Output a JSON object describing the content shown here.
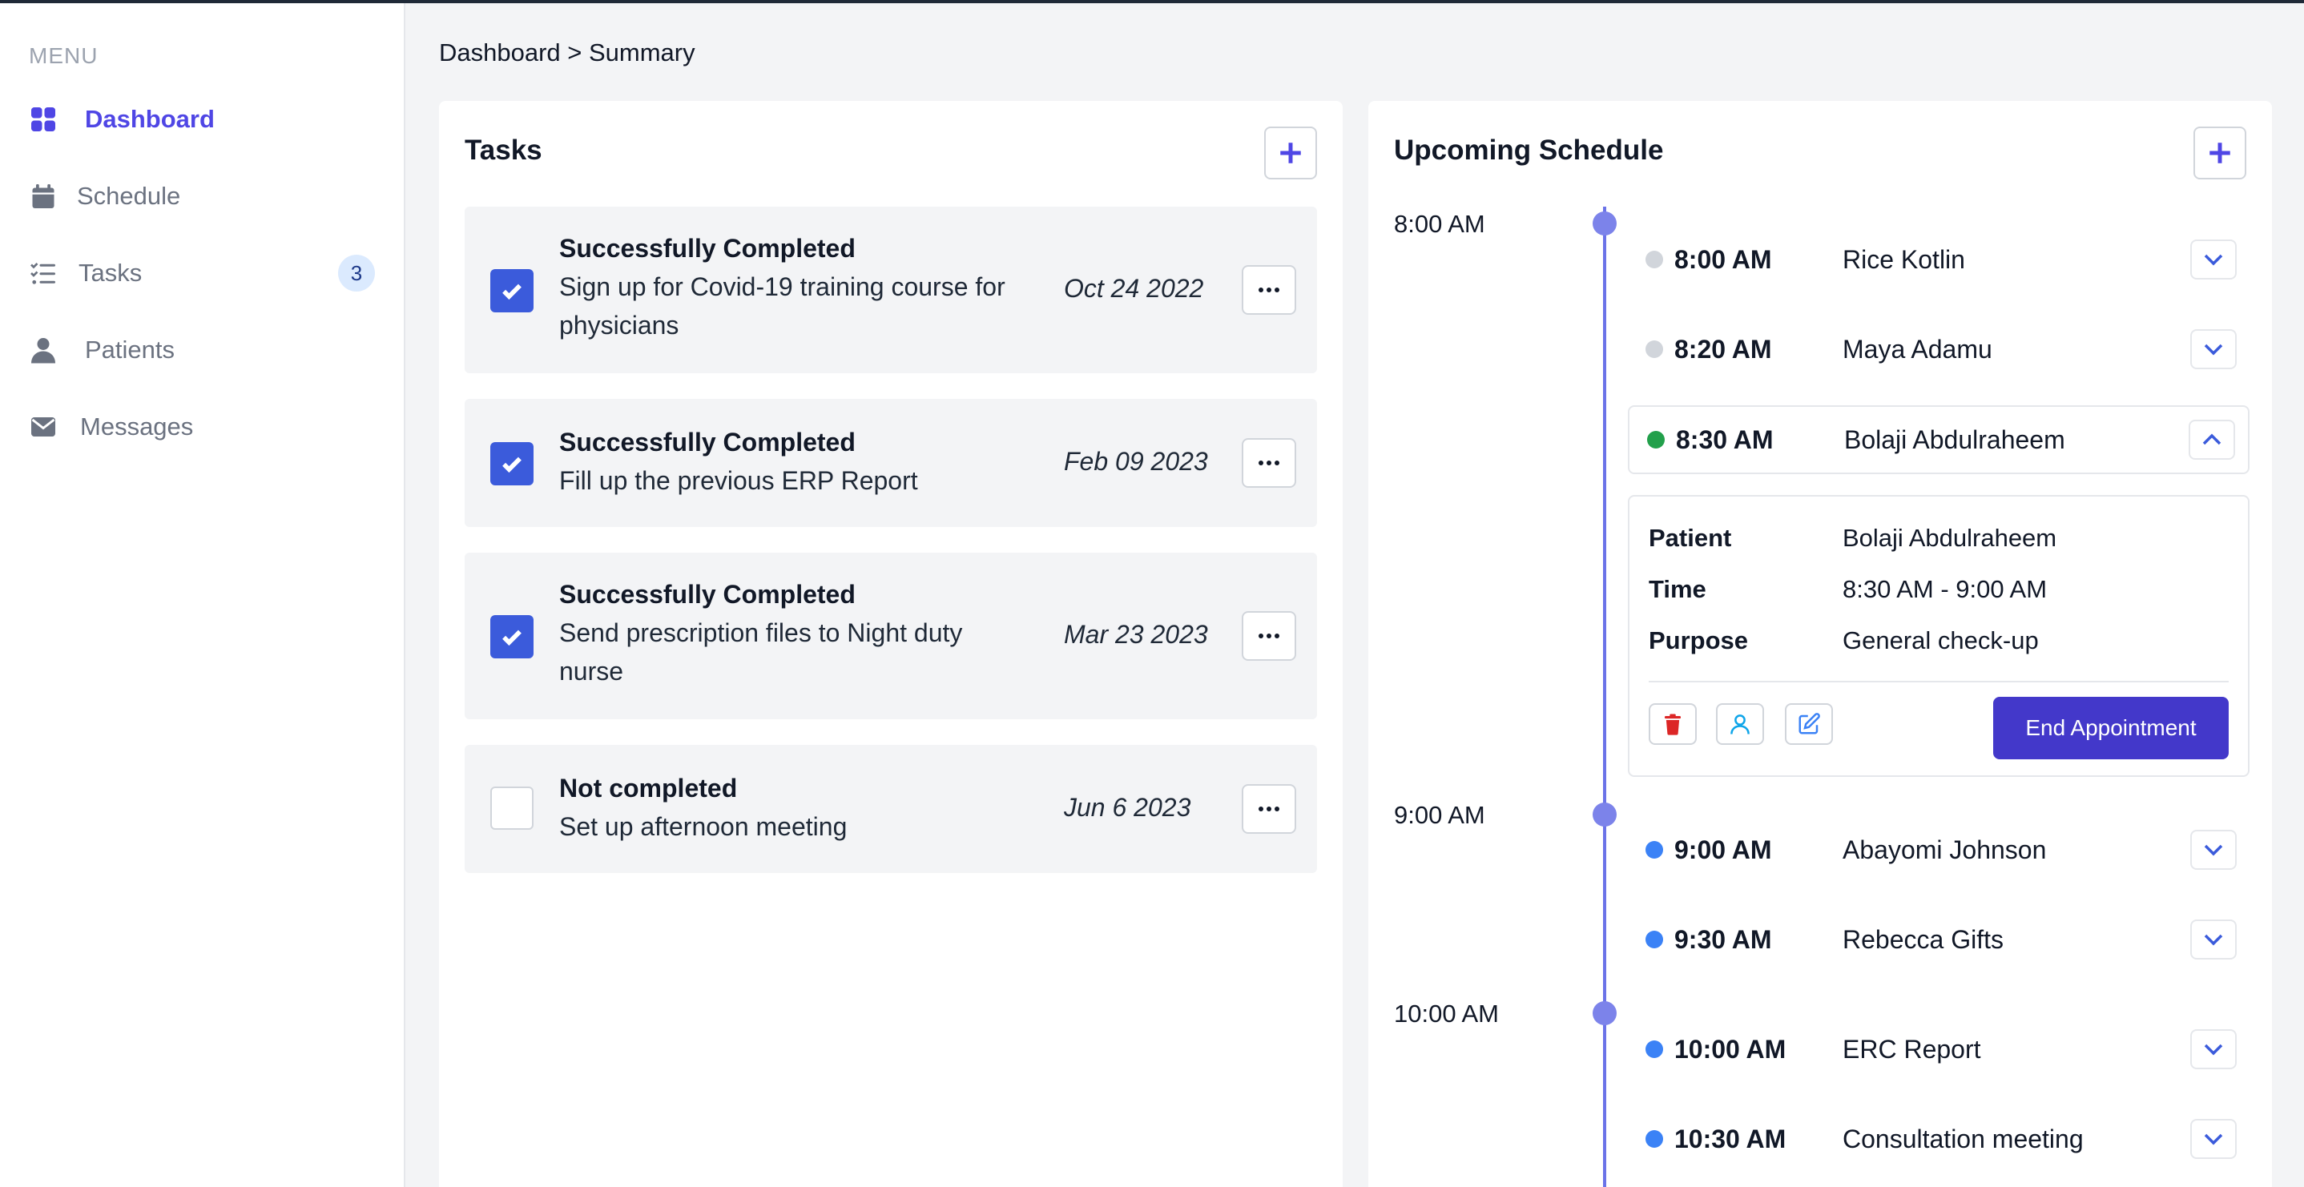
{
  "sidebar": {
    "menu_title": "MENU",
    "items": [
      {
        "label": "Dashboard",
        "icon": "grid-icon",
        "active": true
      },
      {
        "label": "Schedule",
        "icon": "calendar-icon"
      },
      {
        "label": "Tasks",
        "icon": "checklist-icon",
        "badge": "3"
      },
      {
        "label": "Patients",
        "icon": "user-icon"
      },
      {
        "label": "Messages",
        "icon": "mail-icon"
      }
    ]
  },
  "breadcrumb": "Dashboard > Summary",
  "tasks": {
    "title": "Tasks",
    "items": [
      {
        "status": "Successfully Completed",
        "desc": "Sign up for Covid-19 training course for physicians",
        "date": "Oct 24 2022",
        "checked": true
      },
      {
        "status": "Successfully Completed",
        "desc": "Fill up the previous ERP Report",
        "date": "Feb 09 2023",
        "checked": true
      },
      {
        "status": "Successfully Completed",
        "desc": "Send prescription files to Night duty nurse",
        "date": "Mar 23 2023",
        "checked": true
      },
      {
        "status": "Not completed",
        "desc": "Set up afternoon meeting",
        "date": "Jun 6 2023",
        "checked": false
      }
    ]
  },
  "schedule": {
    "title": "Upcoming Schedule",
    "hours": [
      "8:00 AM",
      "9:00 AM",
      "10:00 AM"
    ],
    "appointments": [
      {
        "time": "8:00 AM",
        "name": "Rice Kotlin",
        "status": "past"
      },
      {
        "time": "8:20 AM",
        "name": "Maya Adamu",
        "status": "past"
      },
      {
        "time": "8:30 AM",
        "name": "Bolaji Abdulraheem",
        "status": "current"
      },
      {
        "time": "9:00 AM",
        "name": "Abayomi Johnson",
        "status": "upcoming"
      },
      {
        "time": "9:30 AM",
        "name": "Rebecca Gifts",
        "status": "upcoming"
      },
      {
        "time": "10:00 AM",
        "name": "ERC Report",
        "status": "upcoming"
      },
      {
        "time": "10:30 AM",
        "name": "Consultation meeting",
        "status": "upcoming"
      }
    ],
    "detail": {
      "patient_label": "Patient",
      "patient": "Bolaji Abdulraheem",
      "time_label": "Time",
      "time": "8:30 AM - 9:00 AM",
      "purpose_label": "Purpose",
      "purpose": "General check-up",
      "end_button": "End Appointment"
    }
  },
  "colors": {
    "accent": "#4f46e5",
    "timeline": "#6b73e8",
    "dot_past": "#d1d5db",
    "dot_current": "#22a04b",
    "dot_upcoming": "#3b82f6",
    "delete": "#dc2626",
    "user_action": "#0ea5e9",
    "edit_action": "#3b82f6"
  }
}
